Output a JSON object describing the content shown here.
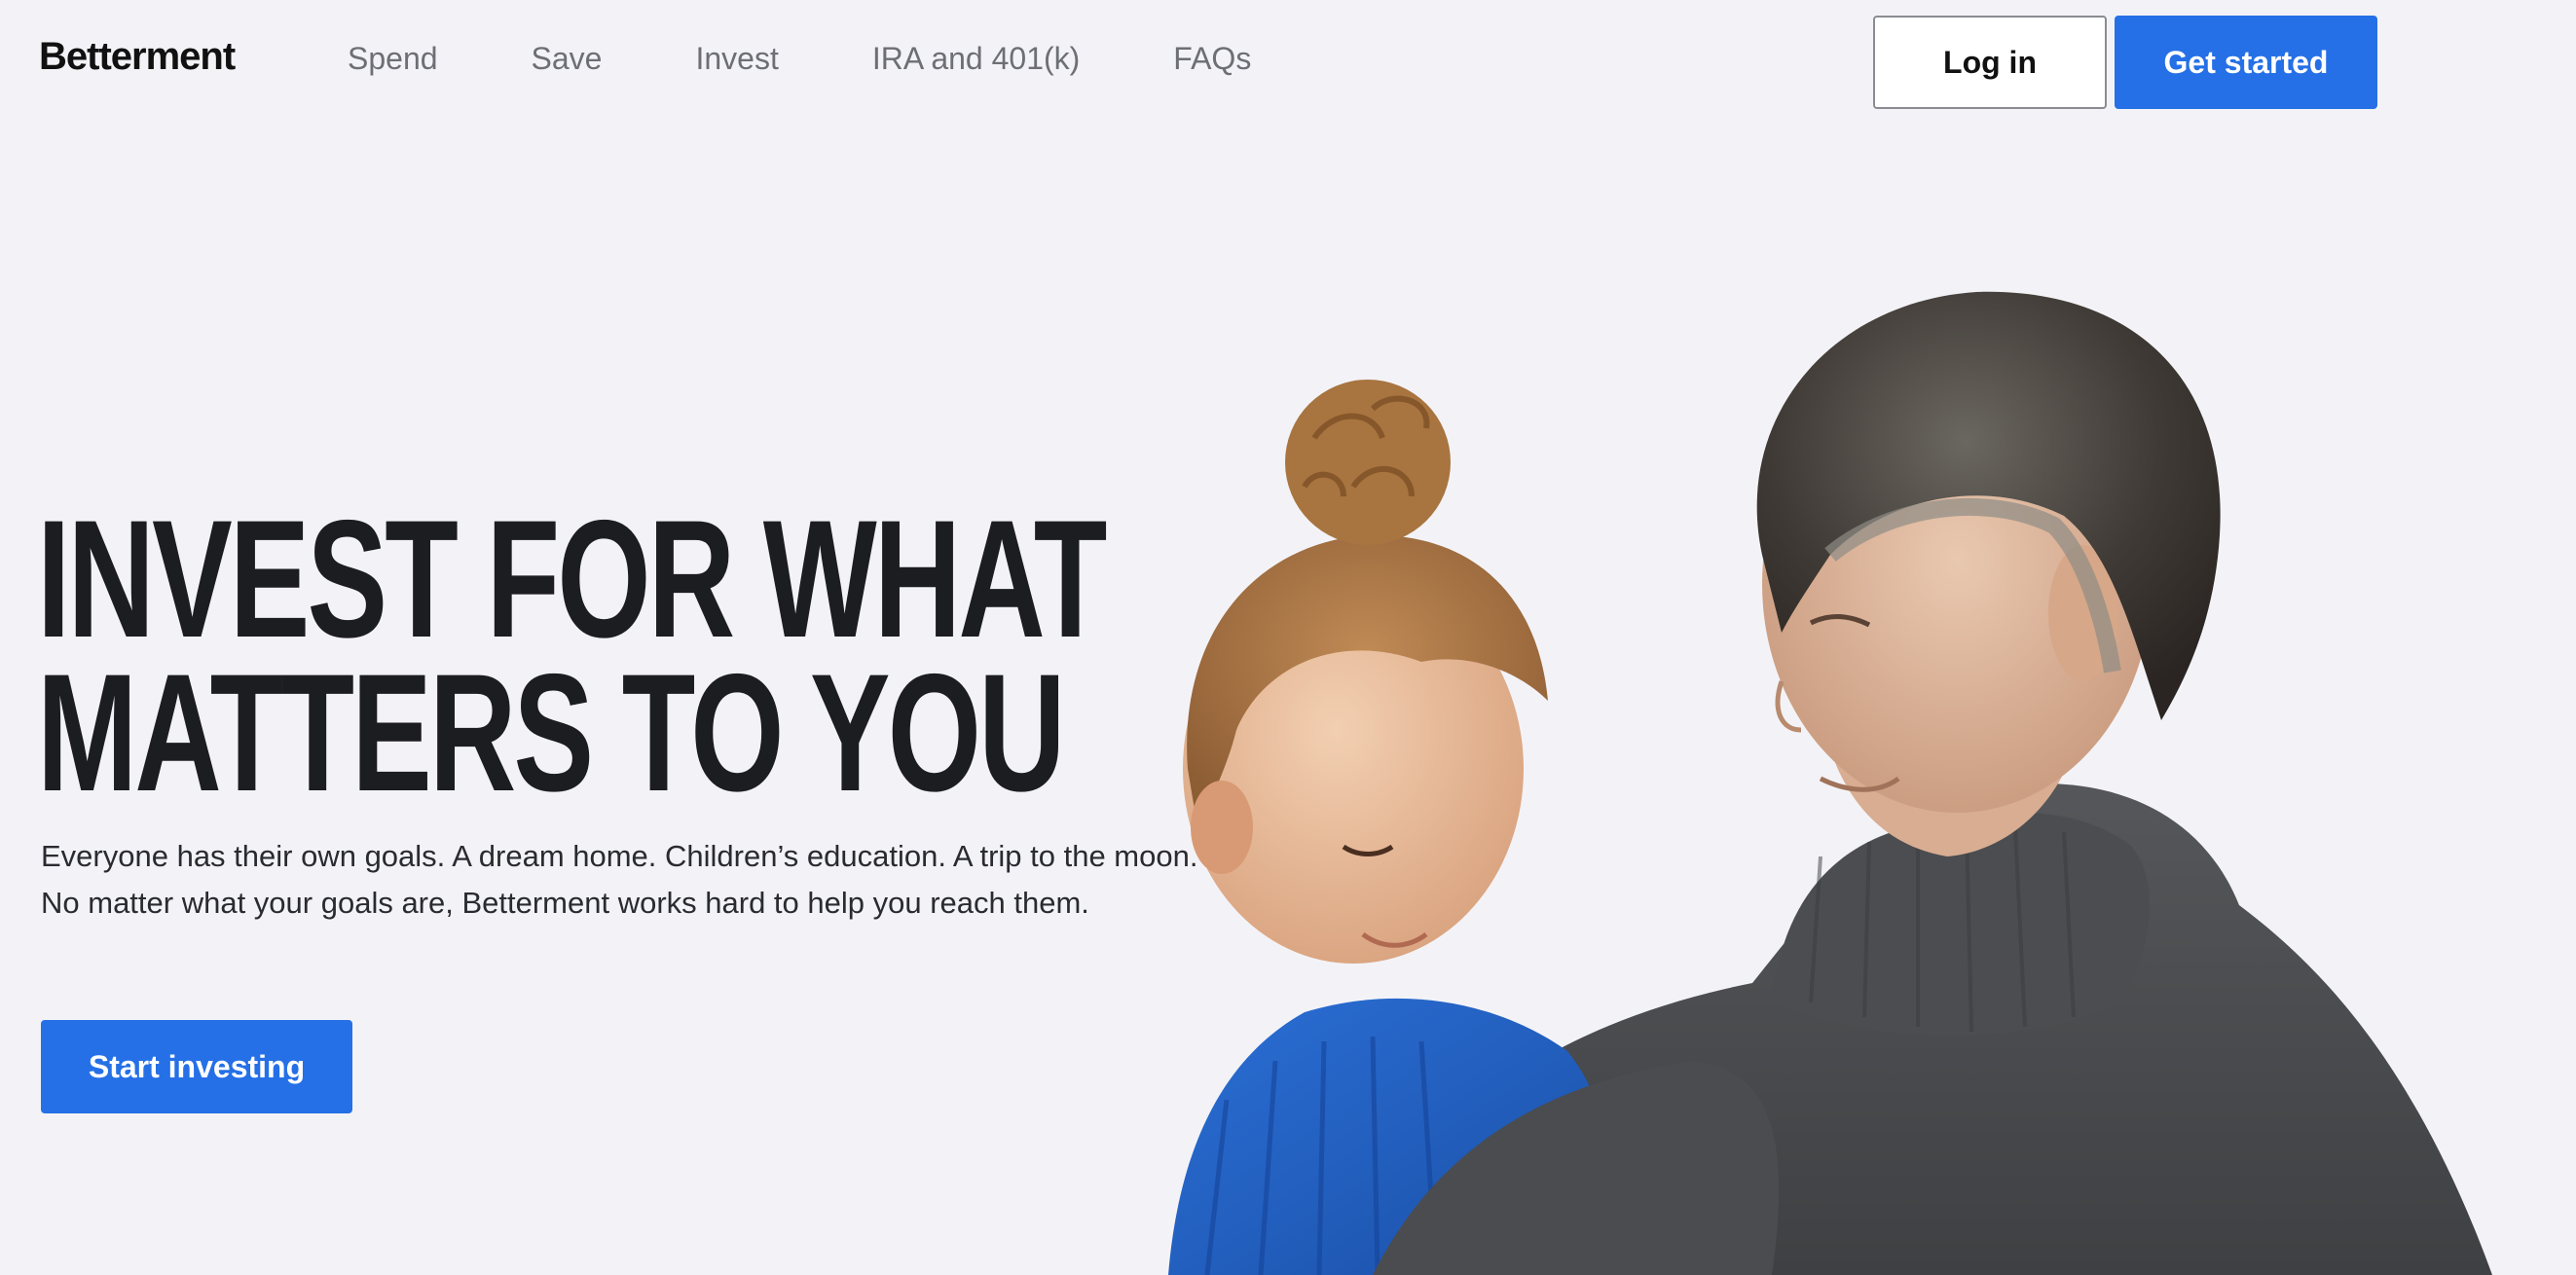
{
  "header": {
    "logo": "Betterment",
    "nav": [
      "Spend",
      "Save",
      "Invest",
      "IRA and 401(k)",
      "FAQs"
    ],
    "login_label": "Log in",
    "get_started_label": "Get started"
  },
  "hero": {
    "title_line1": "INVEST FOR WHAT",
    "title_line2": "MATTERS TO YOU",
    "subtitle": "Everyone has their own goals. A dream home. Children’s education. A trip to the moon. No matter what your goals are, Betterment works hard to help you reach them.",
    "cta_label": "Start investing"
  },
  "colors": {
    "background": "#f3f3f7",
    "accent": "#2570e6",
    "heading": "#1c1d21",
    "nav_text": "#6d6f74"
  },
  "photo": {
    "icon": "father-and-child-photo"
  }
}
